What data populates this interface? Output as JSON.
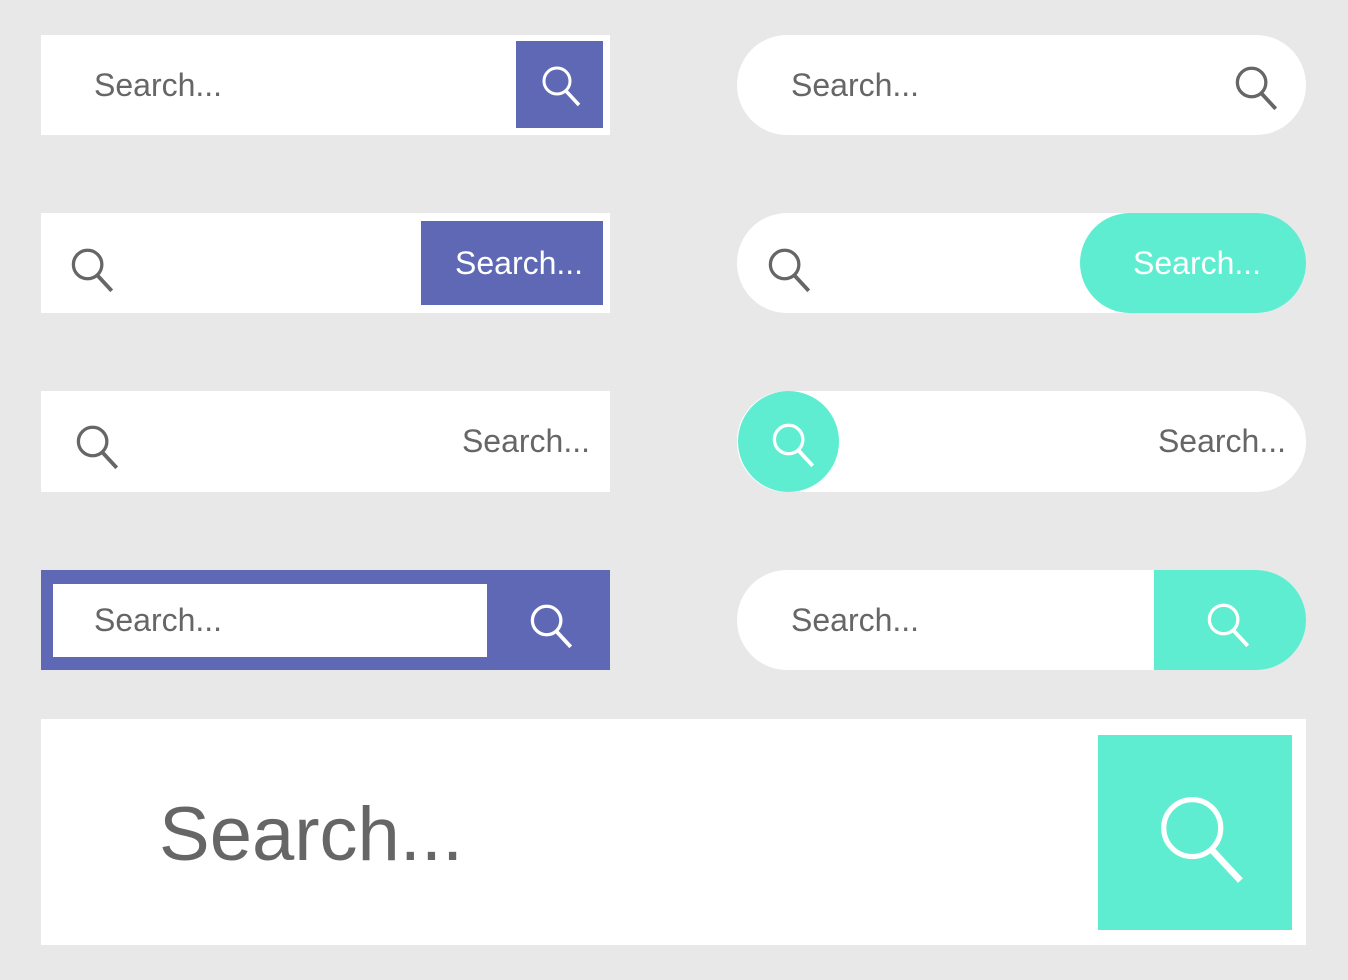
{
  "placeholder": "Search...",
  "colors": {
    "background": "#e8e8e8",
    "purple": "#5f68b5",
    "teal": "#5eedd0",
    "text": "#666666",
    "icon": "#666666"
  },
  "search_bars": [
    {
      "style": "rect-purple-icon-button",
      "text": "Search...",
      "icon": "search-icon"
    },
    {
      "style": "rect-purple-text-button",
      "text": "Search...",
      "icon": "search-icon"
    },
    {
      "style": "rect-plain-right-text",
      "text": "Search...",
      "icon": "search-icon"
    },
    {
      "style": "rect-purple-frame",
      "text": "Search...",
      "icon": "search-icon"
    },
    {
      "style": "pill-plain",
      "text": "Search...",
      "icon": "search-icon"
    },
    {
      "style": "pill-teal-text-button",
      "text": "Search...",
      "icon": "search-icon"
    },
    {
      "style": "pill-teal-circle-icon",
      "text": "Search...",
      "icon": "search-icon"
    },
    {
      "style": "pill-teal-icon-button",
      "text": "Search...",
      "icon": "search-icon"
    },
    {
      "style": "large-teal-icon-button",
      "text": "Search...",
      "icon": "search-icon"
    }
  ]
}
